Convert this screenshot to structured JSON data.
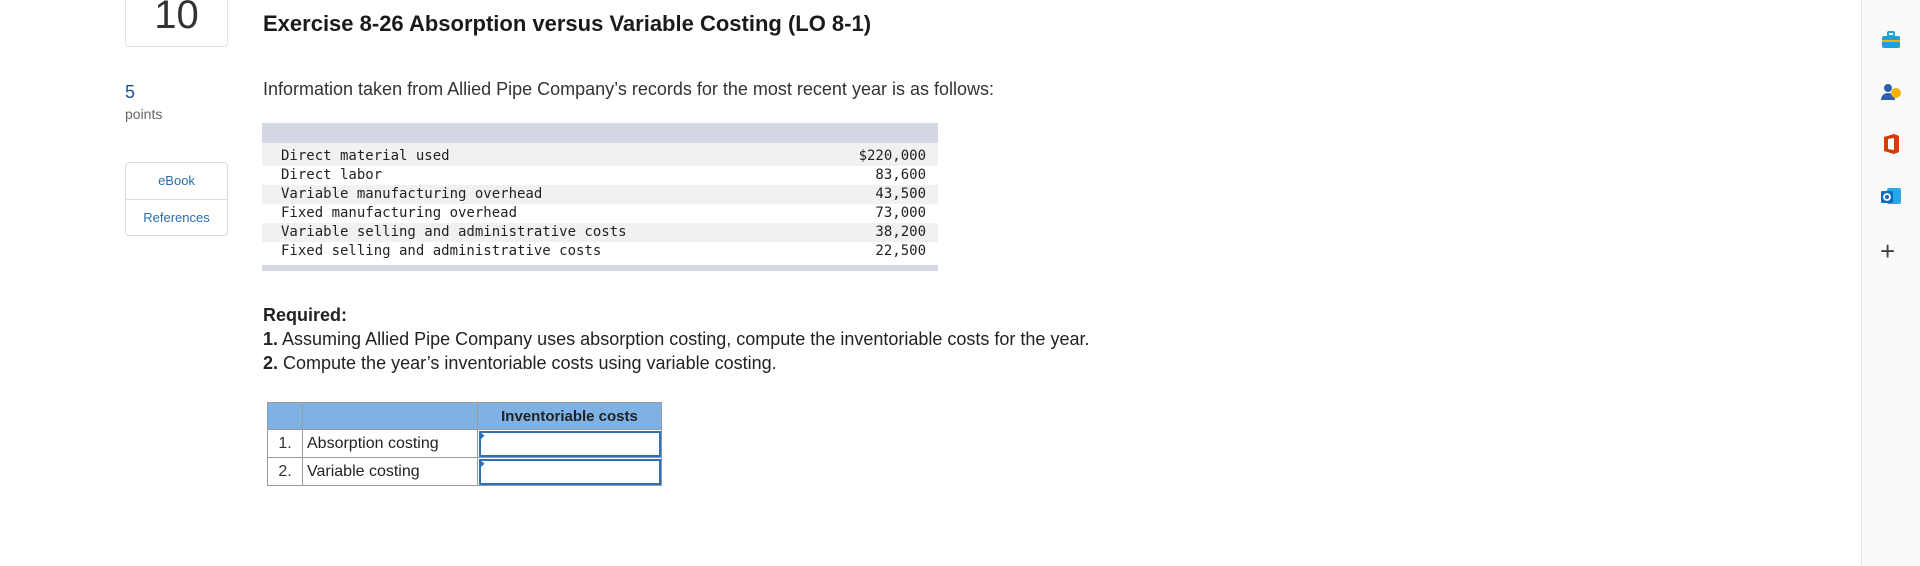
{
  "question": {
    "number": "10",
    "points_value": "5",
    "points_label": "points",
    "side_links": [
      "eBook",
      "References"
    ]
  },
  "exercise": {
    "title": "Exercise 8-26 Absorption versus Variable Costing (LO 8-1)",
    "intro": "Information taken from Allied Pipe Company’s records for the most recent year is as follows:"
  },
  "records": [
    {
      "label": "Direct material used",
      "value": "$220,000"
    },
    {
      "label": "Direct labor",
      "value": "83,600"
    },
    {
      "label": "Variable manufacturing overhead",
      "value": "43,500"
    },
    {
      "label": "Fixed manufacturing overhead",
      "value": "73,000"
    },
    {
      "label": "Variable selling and administrative costs",
      "value": "38,200"
    },
    {
      "label": "Fixed selling and administrative costs",
      "value": "22,500"
    }
  ],
  "required": {
    "heading": "Required:",
    "items": [
      {
        "num": "1.",
        "text": " Assuming Allied Pipe Company uses absorption costing, compute the inventoriable costs for the year."
      },
      {
        "num": "2.",
        "text": " Compute the year’s inventoriable costs using variable costing."
      }
    ]
  },
  "answer_table": {
    "column_header": "Inventoriable costs",
    "rows": [
      {
        "index": "1.",
        "label": "Absorption costing",
        "value": ""
      },
      {
        "index": "2.",
        "label": "Variable costing",
        "value": ""
      }
    ]
  },
  "toolbar": {
    "icons": [
      "briefcase-icon",
      "people-icon",
      "office-icon",
      "outlook-icon"
    ],
    "add_label": "+",
    "colors": {
      "briefcase": "#1f9fd8",
      "people": "#2b5fb4",
      "office": "#d83b01",
      "outlook": "#0f6cbd"
    }
  }
}
